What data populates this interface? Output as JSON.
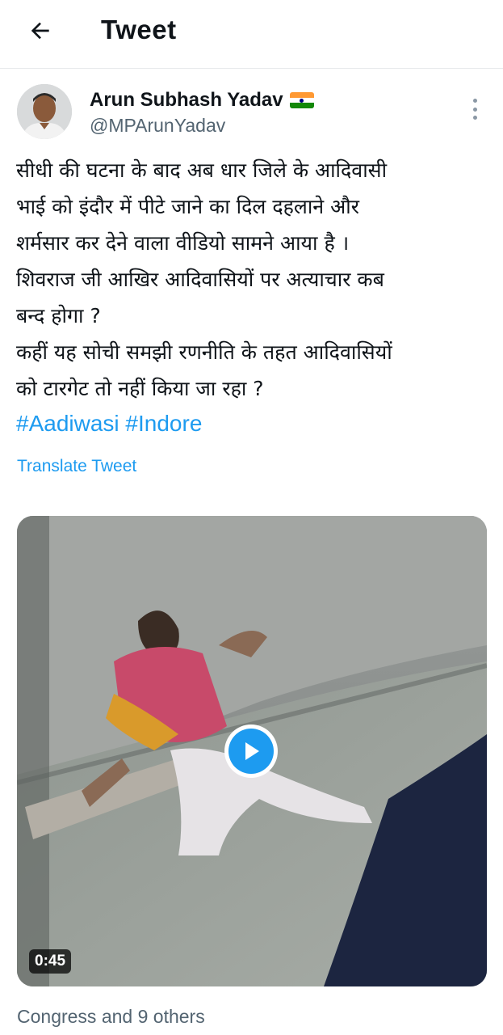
{
  "header": {
    "title": "Tweet",
    "back_icon": "back-arrow-icon"
  },
  "tweet": {
    "author_name": "Arun Subhash Yadav",
    "author_handle": "@MPArunYadav",
    "flag_icon": "india-flag-icon",
    "more_icon": "more-vertical-icon",
    "text_lines": [
      "सीधी की घटना के बाद अब धार जिले के आदिवासी",
      "भाई को इंदौर में पीटे जाने का दिल दहलाने और",
      "शर्मसार कर देने वाला वीडियो सामने आया है ।",
      "शिवराज जी आखिर आदिवासियों पर अत्याचार कब",
      "बन्द होगा ?",
      "कहीं यह सोची समझी रणनीति के तहत आदिवासियों",
      "को टारगेट तो नहीं किया जा रहा ?"
    ],
    "hashtags": [
      "#Aadiwasi",
      "#Indore"
    ],
    "translate_label": "Translate Tweet",
    "video": {
      "duration": "0:45",
      "play_icon": "play-icon"
    },
    "liked_by": "Congress and 9 others"
  },
  "colors": {
    "accent": "#1d9bf0",
    "text": "#0f1419",
    "secondary": "#536471"
  }
}
